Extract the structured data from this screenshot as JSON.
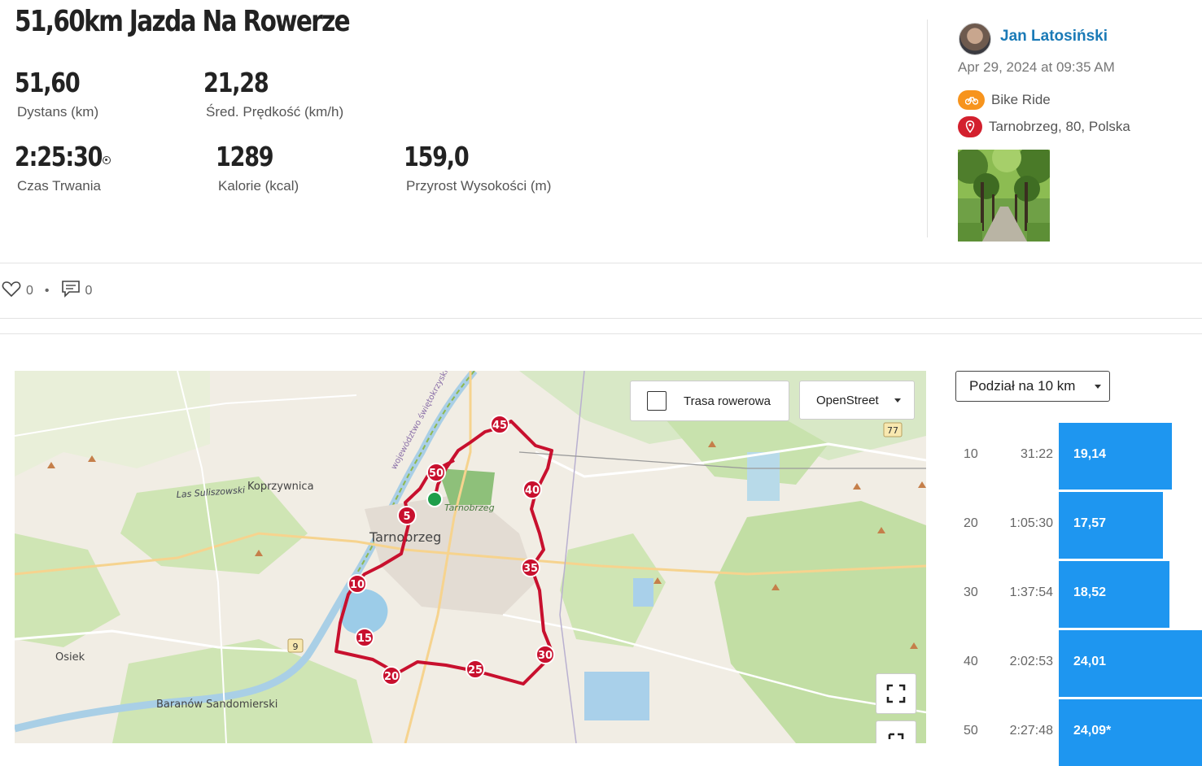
{
  "activity": {
    "title": "51,60km Jazda Na Rowerze",
    "stats": [
      {
        "value": "51,60",
        "label": "Dystans (km)"
      },
      {
        "value": "21,28",
        "label": "Śred. Prędkość (km/h)"
      },
      {
        "value": "2:25:30",
        "label": "Czas Trwania"
      },
      {
        "value": "1289",
        "label": "Kalorie (kcal)"
      },
      {
        "value": "159,0",
        "label": "Przyrost Wysokości (m)"
      }
    ]
  },
  "user": {
    "name": "Jan Latosiński",
    "date": "Apr 29, 2024 at 09:35 AM",
    "activity_type": "Bike Ride",
    "location": "Tarnobrzeg, 80, Polska"
  },
  "social": {
    "likes": "0",
    "comments": "0"
  },
  "map": {
    "bike_route_label": "Trasa rowerowa",
    "layer_select": "OpenStreet",
    "place_labels": {
      "tarnobrzeg": "Tarnobrzeg",
      "tarnobrzeg_small": "Tarnobrzeg",
      "koprzywnica": "Koprzywnica",
      "las": "Las Suliszowski",
      "osiek": "Osiek",
      "baranow": "Baranów Sandomierski",
      "woj": "województwo świętokrzyskie",
      "road9": "9",
      "road77": "77"
    },
    "markers": [
      "5",
      "10",
      "15",
      "20",
      "25",
      "30",
      "35",
      "40",
      "45",
      "50"
    ]
  },
  "splits": {
    "select_label": "Podział na 10 km",
    "rows": [
      {
        "km": "10",
        "time": "31:22",
        "speed": "19,14",
        "fraction": 0.79
      },
      {
        "km": "20",
        "time": "1:05:30",
        "speed": "17,57",
        "fraction": 0.73
      },
      {
        "km": "30",
        "time": "1:37:54",
        "speed": "18,52",
        "fraction": 0.77
      },
      {
        "km": "40",
        "time": "2:02:53",
        "speed": "24,01",
        "fraction": 1.0
      },
      {
        "km": "50",
        "time": "2:27:48",
        "speed": "24,09*",
        "fraction": 1.0
      }
    ]
  },
  "colors": {
    "accent": "#1e96f0",
    "route": "#c8102e",
    "link": "#1a7ab7",
    "ride_badge": "#f7941d",
    "location_badge": "#d3202e"
  }
}
